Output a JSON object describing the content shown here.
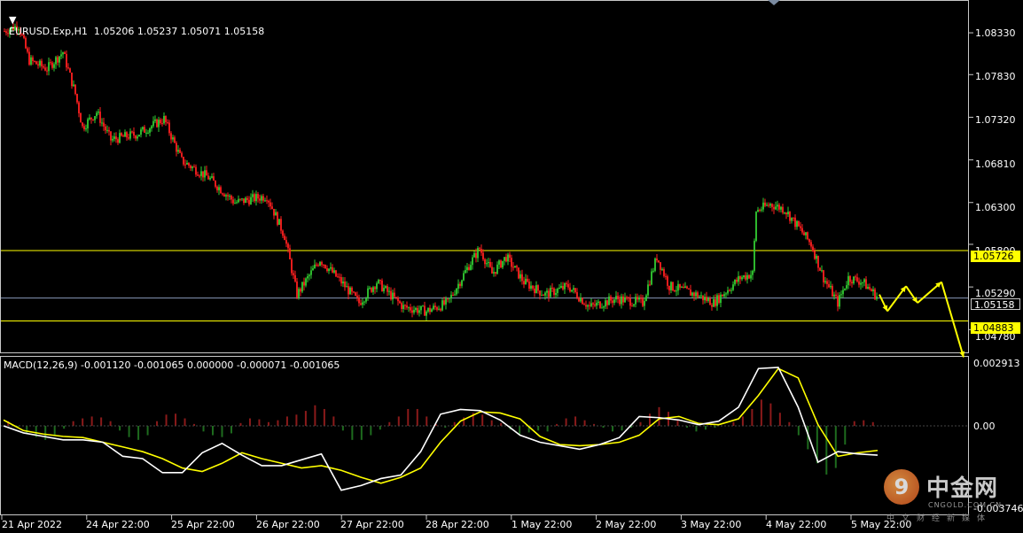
{
  "symbol_header": {
    "menu_arrow": "triangle-down",
    "text": "EURUSD.Exp,H1  1.05206 1.05237 1.05071 1.05158"
  },
  "price_axis": [
    "1.08330",
    "1.07830",
    "1.07320",
    "1.06810",
    "1.06300",
    "1.05800",
    "1.05290",
    "1.04780"
  ],
  "levels": {
    "resistance": "1.05726",
    "current": "1.05158",
    "support": "1.04883"
  },
  "macd": {
    "header": "MACD(12,26,9) -0.001120 -0.001065 0.000000 -0.000071 -0.001065",
    "axis": [
      "0.002913",
      "0.00",
      "-0.003746"
    ]
  },
  "time_axis": [
    "21 Apr 2022",
    "24 Apr 22:00",
    "25 Apr 22:00",
    "26 Apr 22:00",
    "27 Apr 22:00",
    "28 Apr 22:00",
    "1 May 22:00",
    "2 May 22:00",
    "3 May 22:00",
    "4 May 22:00",
    "5 May 22:00"
  ],
  "watermark": {
    "logo_glyph": "9",
    "name": "中金网",
    "domain": "CNGOLD.COM.CN",
    "slogan": "中文财经新媒体"
  },
  "colors": {
    "bull_candle": "#32cd32",
    "bear_candle": "#ff2020",
    "level_line": "#ffff00",
    "current_line": "#8898b8",
    "macd_line": "#ffffff",
    "signal_line": "#ffff00",
    "hist_pos": "#8b1a1a",
    "hist_neg": "#1e6b1e",
    "forecast_arrow": "#ffff00"
  },
  "chart_data": [
    {
      "type": "candlestick",
      "title": "EURUSD.Exp,H1",
      "ylim": [
        1.0455,
        1.0868
      ],
      "key_prices": [
        [
          0,
          1.0835
        ],
        [
          8,
          1.0842
        ],
        [
          14,
          1.08
        ],
        [
          24,
          1.079
        ],
        [
          33,
          1.081
        ],
        [
          40,
          1.076
        ],
        [
          44,
          1.072
        ],
        [
          52,
          1.0738
        ],
        [
          60,
          1.0705
        ],
        [
          75,
          1.0712
        ],
        [
          90,
          1.073
        ],
        [
          100,
          1.068
        ],
        [
          115,
          1.066
        ],
        [
          130,
          1.063
        ],
        [
          148,
          1.0638
        ],
        [
          158,
          1.059
        ],
        [
          165,
          1.052
        ],
        [
          178,
          1.0562
        ],
        [
          190,
          1.0535
        ],
        [
          200,
          1.051
        ],
        [
          210,
          1.0535
        ],
        [
          225,
          1.0505
        ],
        [
          238,
          1.05
        ],
        [
          250,
          1.051
        ],
        [
          262,
          1.0555
        ],
        [
          268,
          1.0575
        ],
        [
          275,
          1.0545
        ],
        [
          283,
          1.0565
        ],
        [
          293,
          1.0535
        ],
        [
          305,
          1.052
        ],
        [
          318,
          1.053
        ],
        [
          330,
          1.0505
        ],
        [
          345,
          1.0515
        ],
        [
          360,
          1.051
        ],
        [
          368,
          1.0565
        ],
        [
          375,
          1.053
        ],
        [
          390,
          1.052
        ],
        [
          400,
          1.051
        ],
        [
          415,
          1.054
        ],
        [
          422,
          1.0545
        ],
        [
          424,
          1.062
        ],
        [
          432,
          1.0628
        ],
        [
          440,
          1.0622
        ],
        [
          448,
          1.06
        ],
        [
          455,
          1.058
        ],
        [
          462,
          1.054
        ],
        [
          470,
          1.051
        ],
        [
          476,
          1.054
        ],
        [
          484,
          1.0535
        ],
        [
          492,
          1.0518
        ]
      ],
      "forecast_path": [
        [
          1.05,
          1.053
        ],
        [
          1.053,
          1.051
        ],
        [
          1.051,
          1.0535
        ],
        [
          1.0535,
          1.0445
        ]
      ]
    },
    {
      "type": "line",
      "title": "MACD(12,26,9)",
      "ylim": [
        -0.003746,
        0.002913
      ],
      "series": [
        {
          "values": [
            0.0,
            -0.0003,
            -0.00045,
            -0.0006,
            -0.0006,
            -0.0007,
            -0.0013,
            -0.0014,
            -0.002,
            -0.002,
            -0.00115,
            -0.00075,
            -0.00125,
            -0.0017,
            -0.0017,
            -0.00145,
            -0.0012,
            -0.00275,
            -0.00255,
            -0.00225,
            -0.0021,
            -0.0011,
            0.0005,
            0.0007,
            0.00065,
            0.00025,
            -0.0004,
            -0.0007,
            -0.00085,
            -0.001,
            -0.0008,
            -0.0005,
            0.0004,
            0.00035,
            0.00025,
            5e-05,
            0.0002,
            0.0008,
            0.00245,
            0.0025,
            0.0008,
            -0.00155,
            -0.0011,
            -0.0012,
            -0.00125
          ]
        },
        {
          "values": [
            0.00025,
            -0.0002,
            -0.00035,
            -0.00045,
            -0.0005,
            -0.0007,
            -0.0009,
            -0.0011,
            -0.0014,
            -0.0018,
            -0.00195,
            -0.0016,
            -0.00115,
            -0.0014,
            -0.0016,
            -0.0018,
            -0.0017,
            -0.0019,
            -0.0022,
            -0.00245,
            -0.0022,
            -0.0018,
            -0.0007,
            0.0002,
            0.0006,
            0.00055,
            0.0003,
            -0.00045,
            -0.0008,
            -0.00085,
            -0.0008,
            -0.0007,
            -0.0004,
            0.0003,
            0.0004,
            0.0001,
            5e-05,
            0.0003,
            0.0013,
            0.00245,
            0.00205,
            5e-05,
            -0.0013,
            -0.00115,
            -0.00105
          ]
        }
      ],
      "histogram": [
        5e-05,
        -2e-05,
        -8e-05,
        -0.00012,
        -0.00015,
        -0.0001,
        -3e-05,
        5e-05,
        8e-05,
        0.0001,
        9e-05,
        5e-05,
        -5e-05,
        -0.00012,
        -0.00015,
        -0.0001,
        5e-05,
        0.00012,
        0.00013,
        8e-05,
        2e-05,
        -6e-05,
        -0.0001,
        -0.00012,
        -8e-05,
        3e-05,
        8e-05,
        7e-05,
        4e-05,
        6e-05,
        0.0001,
        0.00012,
        0.00016,
        0.00022,
        0.00018,
        0.0001,
        -5e-05,
        -0.00015,
        -0.00015,
        -0.0001,
        -4e-05,
        4e-05,
        0.0001,
        0.00018,
        0.00018,
        0.0001,
        2e-05,
        -2e-05,
        4e-05,
        9e-05,
        0.00014,
        0.00012,
        6e-05,
        3e-05,
        -4e-05,
        -9e-05,
        -7e-05,
        -5e-05,
        -6e-05,
        2e-05,
        8e-05,
        0.0001,
        6e-05,
        2e-05,
        -2e-05,
        -6e-05,
        -5e-05,
        -2e-05,
        4e-05,
        0.00013,
        0.0002,
        0.00015,
        6e-05,
        -2e-05,
        -6e-05,
        -4e-05,
        -2e-05,
        0.0,
        4e-05,
        0.0001,
        0.00018,
        0.00028,
        0.00024,
        0.00014,
        4e-05,
        -0.0001,
        -0.00025,
        -0.0004,
        -0.00052,
        -0.00045,
        -0.0002,
        5e-05,
        6e-05,
        4e-05
      ]
    }
  ]
}
